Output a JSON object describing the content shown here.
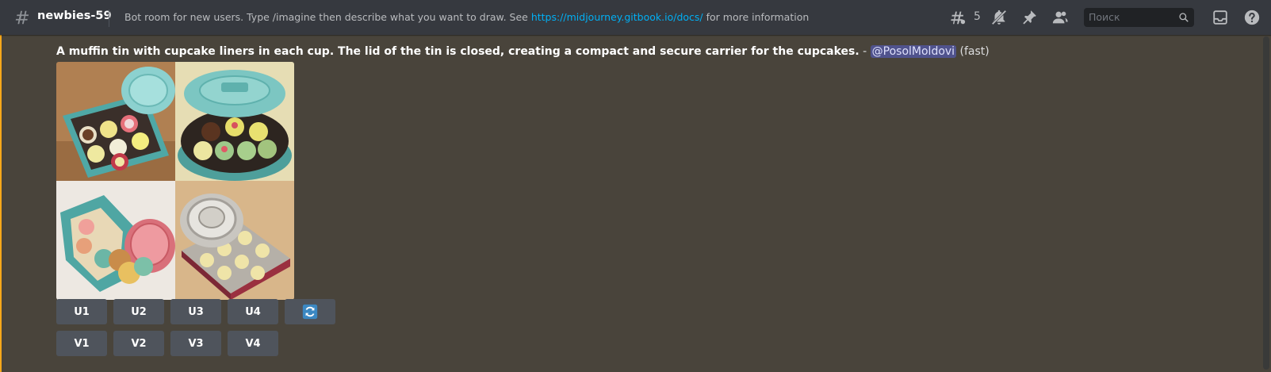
{
  "header": {
    "channel_name": "newbies-59",
    "topic_prefix": "Bot room for new users. Type /imagine then describe what you want to draw. See ",
    "topic_link": "https://midjourney.gitbook.io/docs/",
    "topic_suffix": " for more information",
    "threads_count": "5",
    "search_placeholder": "Поиск",
    "icons": [
      "hashtag-threads-icon",
      "mute-bell-icon",
      "pin-icon",
      "members-icon",
      "search-icon",
      "inbox-icon",
      "help-icon"
    ]
  },
  "message": {
    "prompt": "A muffin tin with cupcake liners in each cup. The lid of the tin is closed, creating a compact and secure carrier for the cupcakes.",
    "separator": " - ",
    "mention": "@PosolMoldovi",
    "speed": "(fast)"
  },
  "buttons": {
    "upscale": [
      "U1",
      "U2",
      "U3",
      "U4"
    ],
    "variation": [
      "V1",
      "V2",
      "V3",
      "V4"
    ],
    "reroll_icon": "reroll-icon"
  },
  "colors": {
    "accent_link": "#00aff4",
    "mention_bar": "#faa81a",
    "button_bg": "#4f545c",
    "reroll_blue": "#3b88c3"
  }
}
